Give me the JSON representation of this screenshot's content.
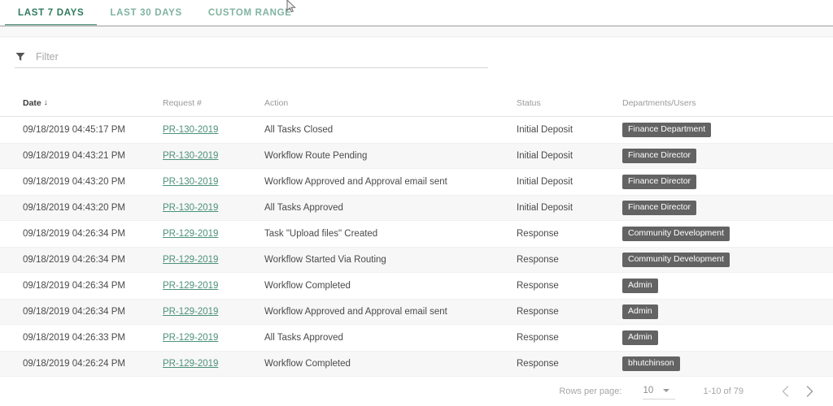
{
  "tabs": [
    {
      "label": "LAST 7 DAYS",
      "active": true
    },
    {
      "label": "LAST 30 DAYS",
      "active": false
    },
    {
      "label": "CUSTOM RANGE",
      "active": false
    }
  ],
  "filter": {
    "icon": "filter-icon",
    "value": "",
    "placeholder": "Filter"
  },
  "table": {
    "columns": [
      {
        "key": "date",
        "label": "Date",
        "sorted": true,
        "sort_arrow": "↓"
      },
      {
        "key": "req",
        "label": "Request #",
        "sorted": false,
        "sort_arrow": ""
      },
      {
        "key": "action",
        "label": "Action",
        "sorted": false,
        "sort_arrow": ""
      },
      {
        "key": "status",
        "label": "Status",
        "sorted": false,
        "sort_arrow": ""
      },
      {
        "key": "dept",
        "label": "Departments/Users",
        "sorted": false,
        "sort_arrow": ""
      }
    ],
    "rows": [
      {
        "date": "09/18/2019 04:45:17 PM",
        "req": "PR-130-2019",
        "action": "All Tasks Closed",
        "status": "Initial Deposit",
        "dept": "Finance Department"
      },
      {
        "date": "09/18/2019 04:43:21 PM",
        "req": "PR-130-2019",
        "action": "Workflow Route Pending",
        "status": "Initial Deposit",
        "dept": "Finance Director"
      },
      {
        "date": "09/18/2019 04:43:20 PM",
        "req": "PR-130-2019",
        "action": "Workflow Approved and Approval email sent",
        "status": "Initial Deposit",
        "dept": "Finance Director"
      },
      {
        "date": "09/18/2019 04:43:20 PM",
        "req": "PR-130-2019",
        "action": "All Tasks Approved",
        "status": "Initial Deposit",
        "dept": "Finance Director"
      },
      {
        "date": "09/18/2019 04:26:34 PM",
        "req": "PR-129-2019",
        "action": "Task \"Upload files\" Created",
        "status": "Response",
        "dept": "Community Development"
      },
      {
        "date": "09/18/2019 04:26:34 PM",
        "req": "PR-129-2019",
        "action": "Workflow Started Via Routing",
        "status": "Response",
        "dept": "Community Development"
      },
      {
        "date": "09/18/2019 04:26:34 PM",
        "req": "PR-129-2019",
        "action": "Workflow Completed",
        "status": "Response",
        "dept": "Admin"
      },
      {
        "date": "09/18/2019 04:26:34 PM",
        "req": "PR-129-2019",
        "action": "Workflow Approved and Approval email sent",
        "status": "Response",
        "dept": "Admin"
      },
      {
        "date": "09/18/2019 04:26:33 PM",
        "req": "PR-129-2019",
        "action": "All Tasks Approved",
        "status": "Response",
        "dept": "Admin"
      },
      {
        "date": "09/18/2019 04:26:24 PM",
        "req": "PR-129-2019",
        "action": "Workflow Completed",
        "status": "Response",
        "dept": "bhutchinson"
      }
    ]
  },
  "paginator": {
    "rows_per_page_label": "Rows per page:",
    "rows_per_page_value": "10",
    "range_label": "1-10 of 79",
    "prev_icon": "chevron-left-icon",
    "next_icon": "chevron-right-icon"
  },
  "colors": {
    "accent": "#2f7a5e",
    "tab_inactive": "#80b3a0",
    "link": "#4c9179",
    "badge_bg": "#636363",
    "row_alt_bg": "#f7f7f7"
  }
}
